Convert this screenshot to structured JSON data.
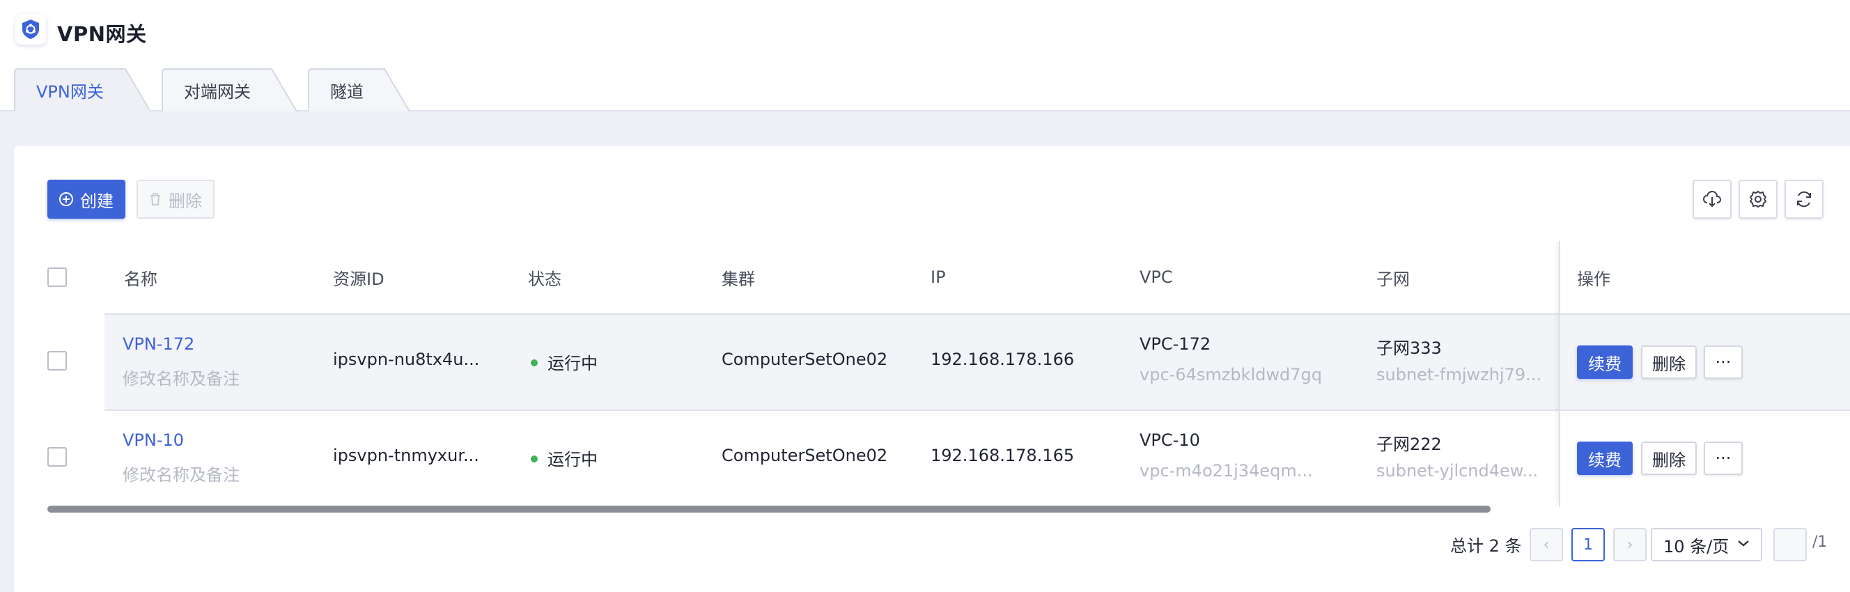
{
  "app": {
    "title": "VPN网关"
  },
  "tabs": [
    {
      "label": "VPN网关",
      "active": true
    },
    {
      "label": "对端网关",
      "active": false
    },
    {
      "label": "隧道",
      "active": false
    }
  ],
  "toolbar": {
    "create_label": "创建",
    "delete_label": "删除",
    "icons": [
      "cloud-download-icon",
      "gear-icon",
      "refresh-icon"
    ]
  },
  "table": {
    "columns": [
      "名称",
      "资源ID",
      "状态",
      "集群",
      "IP",
      "VPC",
      "子网",
      "操作"
    ],
    "rows": [
      {
        "name": "VPN-172",
        "name_sub": "修改名称及备注",
        "resource_id": "ipsvpn-nu8tx4u...",
        "status": "运行中",
        "cluster": "ComputerSetOne02",
        "ip": "192.168.178.166",
        "vpc": "VPC-172",
        "vpc_id": "vpc-64smzbkldwd7gq",
        "subnet": "子网333",
        "subnet_id": "subnet-fmjwzhj79...",
        "renew": "续费",
        "delete": "删除",
        "more": "···"
      },
      {
        "name": "VPN-10",
        "name_sub": "修改名称及备注",
        "resource_id": "ipsvpn-tnmyxur...",
        "status": "运行中",
        "cluster": "ComputerSetOne02",
        "ip": "192.168.178.165",
        "vpc": "VPC-10",
        "vpc_id": "vpc-m4o21j34eqm...",
        "subnet": "子网222",
        "subnet_id": "subnet-yjlcnd4ew...",
        "renew": "续费",
        "delete": "删除",
        "more": "···"
      }
    ]
  },
  "pagination": {
    "total_text": "总计 2 条",
    "current_page": "1",
    "page_size": "10 条/页",
    "total_pages": "/1",
    "prev": "‹",
    "next": "›"
  },
  "colors": {
    "primary": "#3d63d9",
    "status_running": "#45b05a",
    "background": "#eef0f6"
  }
}
